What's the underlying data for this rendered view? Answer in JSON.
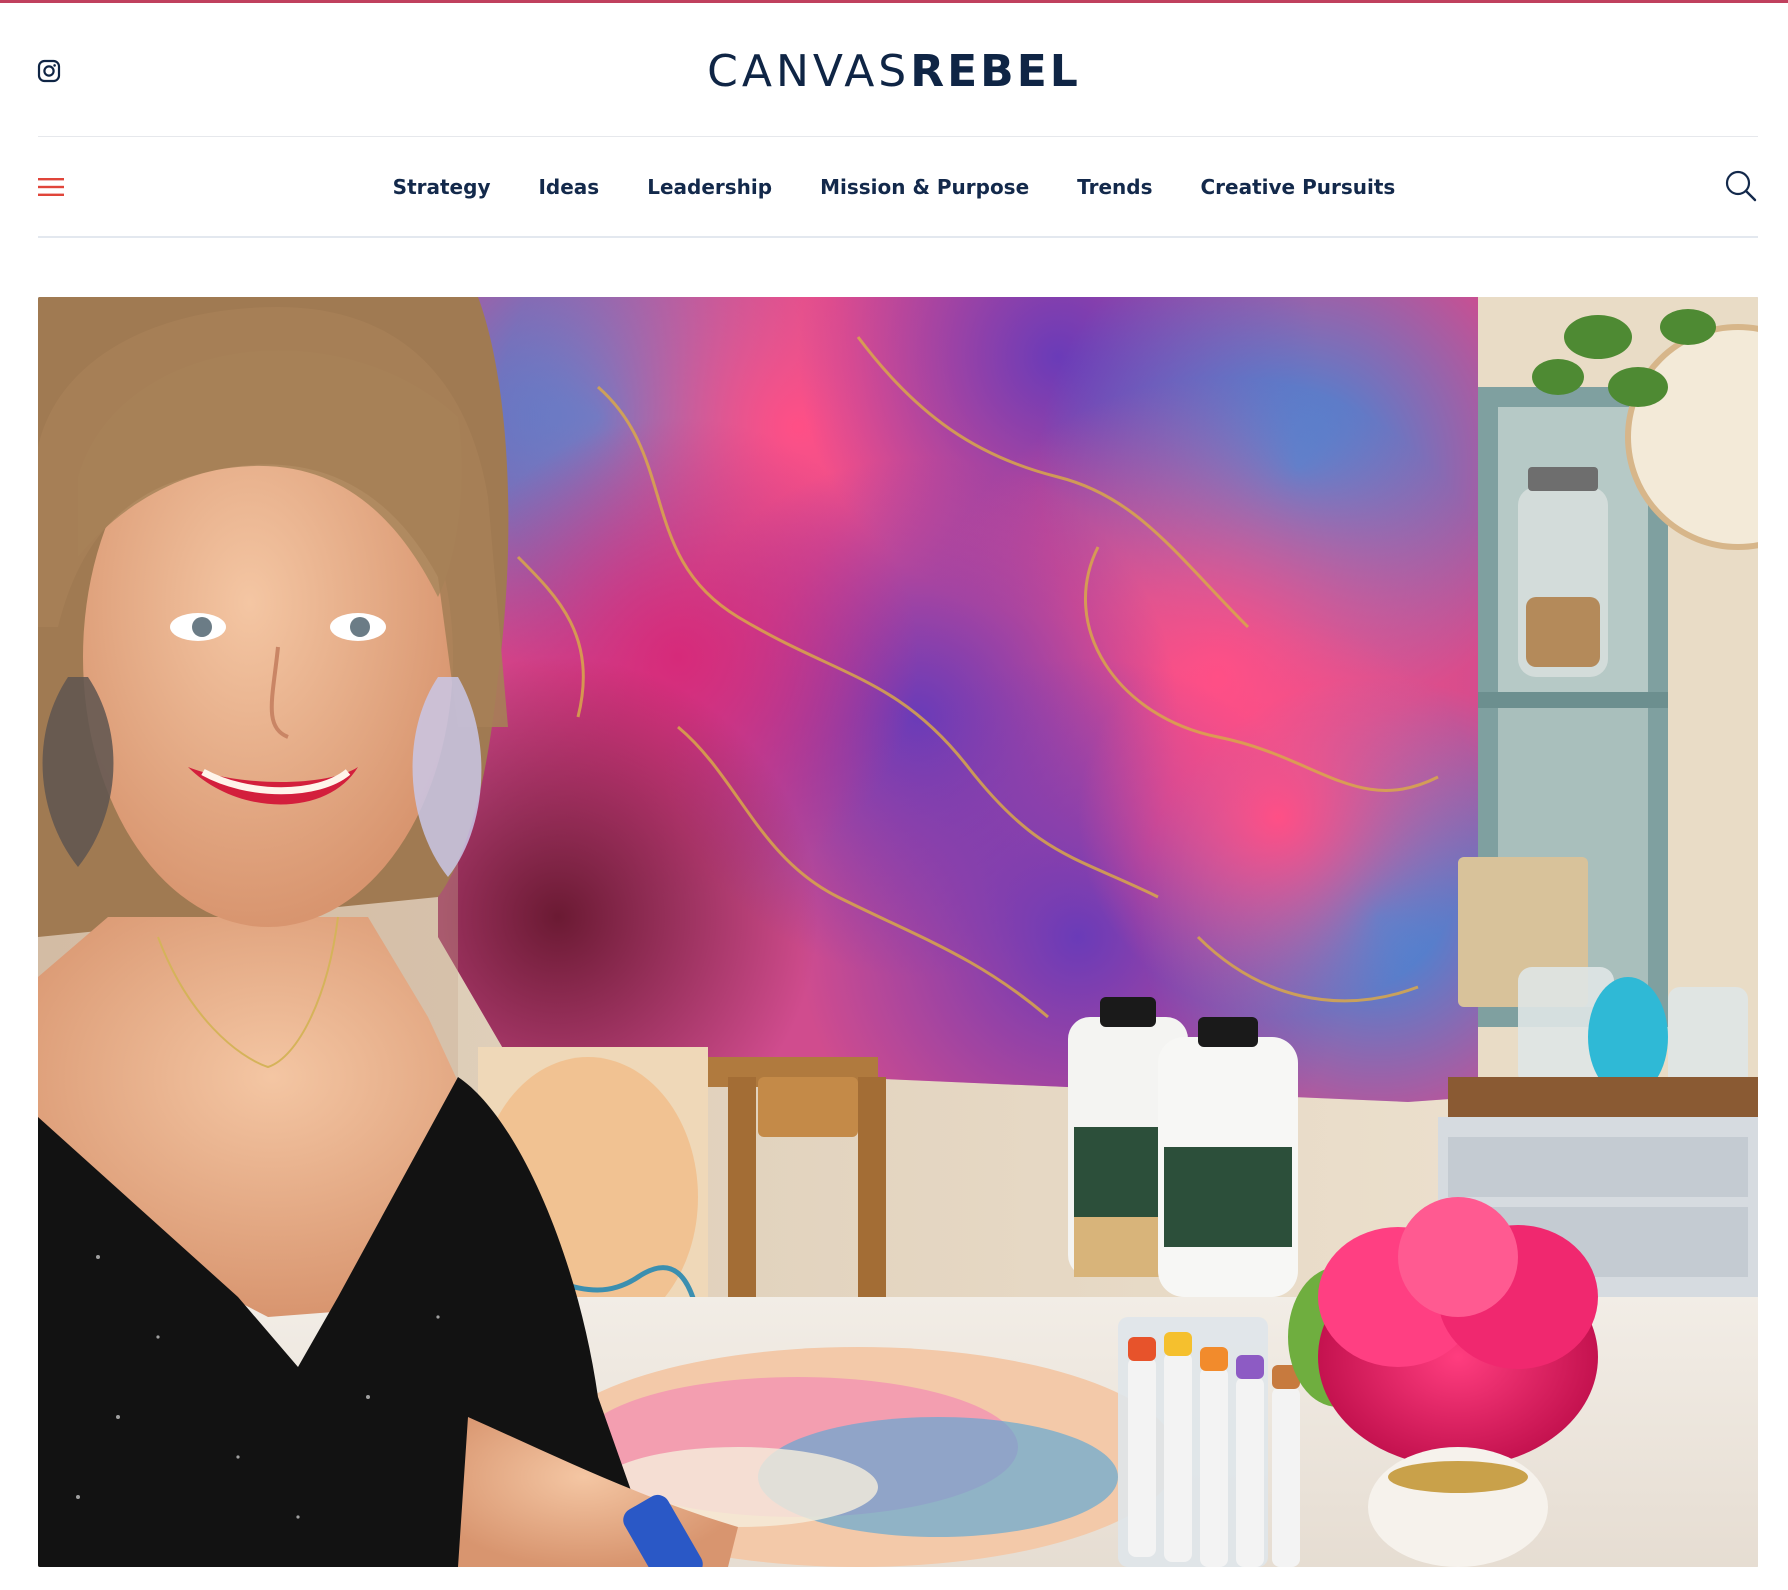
{
  "site": {
    "logo_light": "CANVAS",
    "logo_bold": "REBEL",
    "accent_color": "#c0405e",
    "brand_color": "#0f2545",
    "menu_icon_color": "#e0453a"
  },
  "header": {
    "social_icon": "instagram-icon",
    "menu_icon": "hamburger-menu-icon",
    "search_icon": "search-icon"
  },
  "nav": {
    "items": [
      {
        "label": "Strategy"
      },
      {
        "label": "Ideas"
      },
      {
        "label": "Leadership"
      },
      {
        "label": "Mission & Purpose"
      },
      {
        "label": "Trends"
      },
      {
        "label": "Creative Pursuits"
      }
    ]
  },
  "hero": {
    "alt": "Artist smiling in front of a large pink, purple and blue alcohol ink painting in her studio"
  }
}
